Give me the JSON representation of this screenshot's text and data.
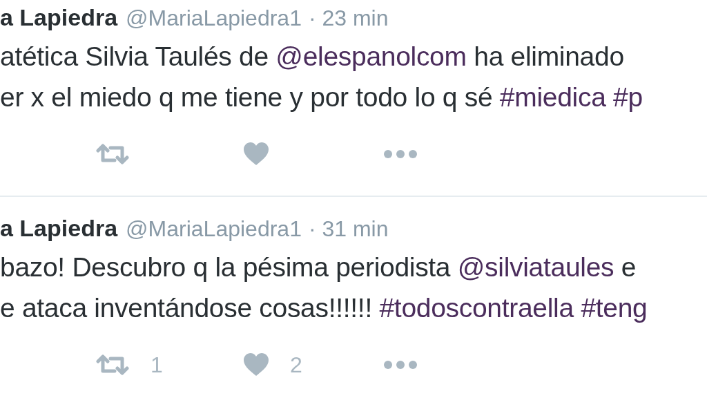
{
  "tweets": [
    {
      "name": "a Lapiedra",
      "handle": "@MariaLapiedra1",
      "time": "· 23 min",
      "lines": [
        [
          {
            "kind": "text",
            "text": "atética Silvia Taulés de "
          },
          {
            "kind": "mention",
            "text": "@elespanolcom"
          },
          {
            "kind": "text",
            "text": " ha eliminado"
          }
        ],
        [
          {
            "kind": "text",
            "text": "er x el miedo q me tiene y por todo lo q sé "
          },
          {
            "kind": "hashtag",
            "text": "#miedica"
          },
          {
            "kind": "hashtag",
            "text": "#p"
          }
        ]
      ],
      "actions": [
        {
          "kind": "retweet"
        },
        {
          "kind": "like"
        },
        {
          "kind": "more"
        }
      ]
    },
    {
      "name": "a Lapiedra",
      "handle": "@MariaLapiedra1",
      "time": "· 31 min",
      "lines": [
        [
          {
            "kind": "text",
            "text": "bazo! Descubro q la pésima periodista "
          },
          {
            "kind": "mention",
            "text": "@silviataules"
          },
          {
            "kind": "text",
            "text": " e"
          }
        ],
        [
          {
            "kind": "text",
            "text": "e ataca inventándose cosas!!!!!! "
          },
          {
            "kind": "hashtag",
            "text": "#todoscontraella"
          },
          {
            "kind": "hashtag",
            "text": "#teng"
          }
        ]
      ],
      "actions": [
        {
          "kind": "retweet",
          "count": "1"
        },
        {
          "kind": "like",
          "count": "2"
        },
        {
          "kind": "more"
        }
      ]
    }
  ]
}
